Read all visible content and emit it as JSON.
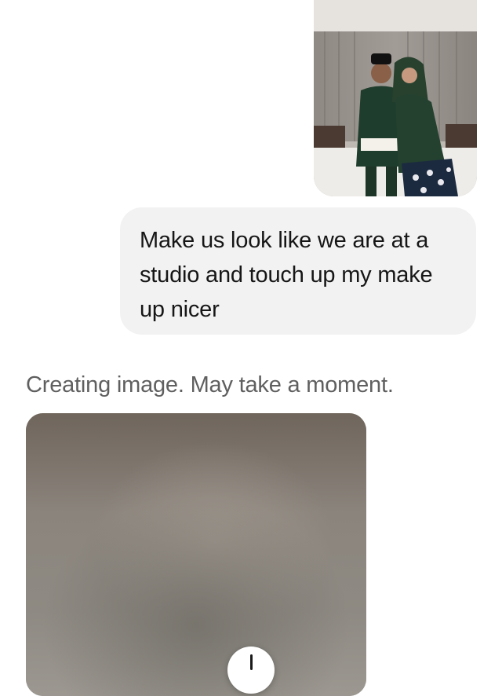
{
  "conversation": {
    "user_message": {
      "photo_icon": "uploaded-couple-photo",
      "text": "Make us look like we are at a studio and touch up my make up nicer"
    },
    "assistant_message": {
      "status": "Creating image. May take a moment.",
      "image_placeholder_icon": "blurred-generating-image"
    },
    "scroll_down_icon": "arrow-down-icon"
  },
  "colors": {
    "bubble": "#f2f2f2",
    "status_text": "#5f5f5f",
    "background": "#ffffff"
  }
}
